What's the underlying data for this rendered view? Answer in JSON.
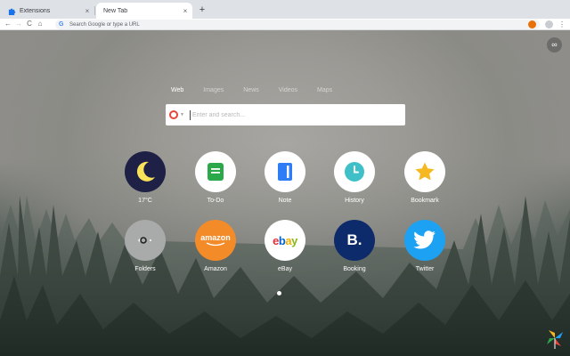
{
  "browser": {
    "tabs": [
      {
        "title": "Extensions",
        "close": "×",
        "favicon": "puzzle-icon"
      },
      {
        "title": "New Tab",
        "close": "×"
      }
    ],
    "new_tab": "+",
    "toolbar": {
      "back": "←",
      "forward": "→",
      "reload": "C",
      "home": "⌂",
      "omnibox_placeholder": "Search Google or type a URL",
      "star": "☆",
      "menu": "⋮"
    }
  },
  "page": {
    "menu_button": "∞",
    "search_tabs": [
      "Web",
      "Images",
      "News",
      "Videos",
      "Maps"
    ],
    "search_placeholder": "Enter and search...",
    "tiles": [
      {
        "label": "17°C",
        "icon": "moon-icon"
      },
      {
        "label": "To-Do",
        "icon": "todo-icon"
      },
      {
        "label": "Note",
        "icon": "note-icon"
      },
      {
        "label": "History",
        "icon": "clock-icon"
      },
      {
        "label": "Bookmark",
        "icon": "star-icon"
      },
      {
        "label": "Folders",
        "icon": "folder-icon"
      },
      {
        "label": "Amazon",
        "icon": "amazon-logo",
        "logo_text": "amazon"
      },
      {
        "label": "eBay",
        "icon": "ebay-logo"
      },
      {
        "label": "Booking",
        "icon": "booking-logo",
        "logo_text": "B."
      },
      {
        "label": "Twitter",
        "icon": "twitter-bird-icon"
      }
    ]
  },
  "colors": {
    "amazon": "#f48b29",
    "booking": "#0d2b6b",
    "twitter": "#1da1f2",
    "moon_bg": "#1e2046",
    "moon": "#f7e25a",
    "todo": "#2aa84a",
    "note": "#2f7df6",
    "history": "#3fc0c8",
    "bookmark": "#f5b820"
  }
}
